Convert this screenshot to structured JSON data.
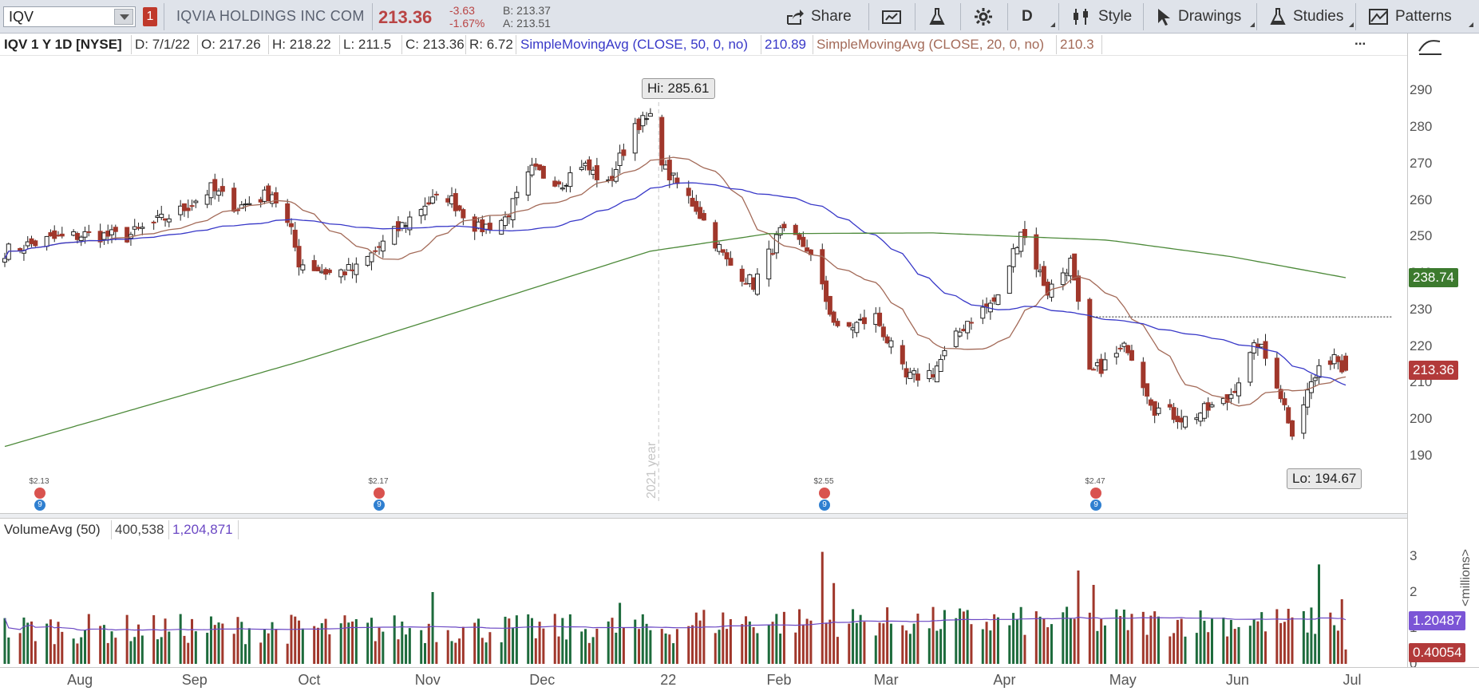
{
  "toolbar": {
    "symbol": "IQV",
    "link_badge": "1",
    "company_name": "IQVIA HOLDINGS INC COM",
    "last_price": "213.36",
    "net_change": "-3.63",
    "pct_change": "-1.67%",
    "bid": "B: 213.37",
    "ask": "A: 213.51",
    "share_label": "Share",
    "period_label": "D",
    "style_label": "Style",
    "drawings_label": "Drawings",
    "studies_label": "Studies",
    "patterns_label": "Patterns",
    "colors": {
      "background": "#dfe3ea",
      "negative": "#b94444"
    }
  },
  "infobar": {
    "title": "IQV 1 Y 1D [NYSE]",
    "date": "D: 7/1/22",
    "open": "O: 217.26",
    "high": "H: 218.22",
    "low": "L: 211.5",
    "close": "C: 213.36",
    "range": "R: 6.72",
    "sma50_label": "SimpleMovingAvg (CLOSE, 50, 0, no)",
    "sma50_value": "210.89",
    "sma20_label": "SimpleMovingAvg (CLOSE, 20, 0, no)",
    "sma20_value": "210.3",
    "more": "..."
  },
  "volume_header": {
    "label": "VolumeAvg (50)",
    "volume": "400,538",
    "avg": "1,204,871"
  },
  "annotations": {
    "high_callout": "Hi: 285.61",
    "low_callout": "Lo: 194.67",
    "year_marker": "2021 year"
  },
  "right_axis": {
    "price_ticks": [
      "290",
      "280",
      "270",
      "260",
      "250",
      "240",
      "230",
      "220",
      "210",
      "200",
      "190"
    ],
    "sma200_tag": "238.74",
    "price_tag": "213.36",
    "volume_ticks": [
      "3",
      "2",
      "1",
      "0"
    ],
    "vol_avg_tag": "1.20487",
    "vol_tag": "0.40054",
    "vol_unit": "<millions>"
  },
  "x_axis": {
    "labels": [
      "Aug",
      "Sep",
      "Oct",
      "Nov",
      "Dec",
      "22",
      "Feb",
      "Mar",
      "Apr",
      "May",
      "Jun",
      "Jul"
    ]
  },
  "dividends": [
    {
      "amount": "$2.13"
    },
    {
      "amount": "$2.17"
    },
    {
      "amount": "$2.55"
    },
    {
      "amount": "$2.47"
    }
  ],
  "chart_data": {
    "type": "candlestick",
    "symbol": "IQV",
    "aggregation": "1D",
    "range": "1 Y",
    "ylim": [
      183,
      296
    ],
    "volume_ylim_millions": [
      0,
      3.2
    ],
    "grid": false,
    "anchors_close": [
      {
        "d": "2021-07-15",
        "v": 246
      },
      {
        "d": "2021-07-26",
        "v": 249
      },
      {
        "d": "2021-08-05",
        "v": 250.5
      },
      {
        "d": "2021-08-16",
        "v": 250
      },
      {
        "d": "2021-08-30",
        "v": 257
      },
      {
        "d": "2021-09-07",
        "v": 263
      },
      {
        "d": "2021-09-14",
        "v": 258
      },
      {
        "d": "2021-09-23",
        "v": 262
      },
      {
        "d": "2021-09-28",
        "v": 251
      },
      {
        "d": "2021-09-30",
        "v": 243
      },
      {
        "d": "2021-10-08",
        "v": 240
      },
      {
        "d": "2021-10-15",
        "v": 241
      },
      {
        "d": "2021-10-22",
        "v": 248
      },
      {
        "d": "2021-11-02",
        "v": 259
      },
      {
        "d": "2021-11-08",
        "v": 261
      },
      {
        "d": "2021-11-16",
        "v": 252
      },
      {
        "d": "2021-11-23",
        "v": 255
      },
      {
        "d": "2021-11-30",
        "v": 268
      },
      {
        "d": "2021-12-08",
        "v": 265
      },
      {
        "d": "2021-12-13",
        "v": 270
      },
      {
        "d": "2021-12-20",
        "v": 264
      },
      {
        "d": "2021-12-27",
        "v": 281
      },
      {
        "d": "2021-12-31",
        "v": 282
      },
      {
        "d": "2022-01-04",
        "v": 268
      },
      {
        "d": "2022-01-12",
        "v": 258
      },
      {
        "d": "2022-01-20",
        "v": 243
      },
      {
        "d": "2022-01-27",
        "v": 237
      },
      {
        "d": "2022-02-03",
        "v": 251
      },
      {
        "d": "2022-02-10",
        "v": 247
      },
      {
        "d": "2022-02-18",
        "v": 224
      },
      {
        "d": "2022-02-28",
        "v": 228
      },
      {
        "d": "2022-03-08",
        "v": 211
      },
      {
        "d": "2022-03-15",
        "v": 213
      },
      {
        "d": "2022-03-24",
        "v": 227
      },
      {
        "d": "2022-04-01",
        "v": 233
      },
      {
        "d": "2022-04-07",
        "v": 252
      },
      {
        "d": "2022-04-14",
        "v": 235
      },
      {
        "d": "2022-04-20",
        "v": 243
      },
      {
        "d": "2022-04-25",
        "v": 212
      },
      {
        "d": "2022-05-05",
        "v": 220
      },
      {
        "d": "2022-05-12",
        "v": 203
      },
      {
        "d": "2022-05-20",
        "v": 200
      },
      {
        "d": "2022-05-31",
        "v": 205
      },
      {
        "d": "2022-06-08",
        "v": 221
      },
      {
        "d": "2022-06-13",
        "v": 210
      },
      {
        "d": "2022-06-17",
        "v": 197
      },
      {
        "d": "2022-06-22",
        "v": 210
      },
      {
        "d": "2022-06-28",
        "v": 218
      },
      {
        "d": "2022-07-01",
        "v": 213.36
      }
    ],
    "last_bar": {
      "date": "2022-07-01",
      "open": 217.26,
      "high": 218.22,
      "low": 211.5,
      "close": 213.36
    },
    "high": {
      "value": 285.61,
      "date": "2021-12-31"
    },
    "low": {
      "value": 194.67,
      "date": "2022-06-17"
    },
    "sma20_last": 210.3,
    "sma50_last": 210.89,
    "sma200_last": 238.74,
    "sma200_anchors": [
      {
        "d": "2021-07-15",
        "v": 192.5
      },
      {
        "d": "2021-10-01",
        "v": 216
      },
      {
        "d": "2021-12-31",
        "v": 246
      },
      {
        "d": "2022-01-31",
        "v": 250.8
      },
      {
        "d": "2022-03-15",
        "v": 251
      },
      {
        "d": "2022-04-30",
        "v": 249
      },
      {
        "d": "2022-06-01",
        "v": 244.5
      },
      {
        "d": "2022-07-01",
        "v": 238.74
      }
    ],
    "resistance_line": {
      "value": 228,
      "from": "2022-04-25",
      "to": "2022-07-01"
    },
    "volume_avg_last_millions": 1.20487,
    "volume_last_millions": 0.40054,
    "volume_spikes_millions": [
      {
        "d": "2022-02-14",
        "v": 3.12
      },
      {
        "d": "2022-02-17",
        "v": 2.25
      },
      {
        "d": "2022-04-22",
        "v": 2.6
      },
      {
        "d": "2022-04-26",
        "v": 2.2
      },
      {
        "d": "2022-06-24",
        "v": 2.77
      },
      {
        "d": "2022-06-30",
        "v": 1.8
      },
      {
        "d": "2021-11-04",
        "v": 2.0
      },
      {
        "d": "2021-12-23",
        "v": 1.7
      }
    ],
    "series_colors": {
      "up": "#1d6b3c",
      "down": "#a0372b",
      "sma20": "#a36a58",
      "sma50": "#3838c8",
      "sma200": "#4d8a3a",
      "volume_avg": "#6b48c4"
    }
  }
}
